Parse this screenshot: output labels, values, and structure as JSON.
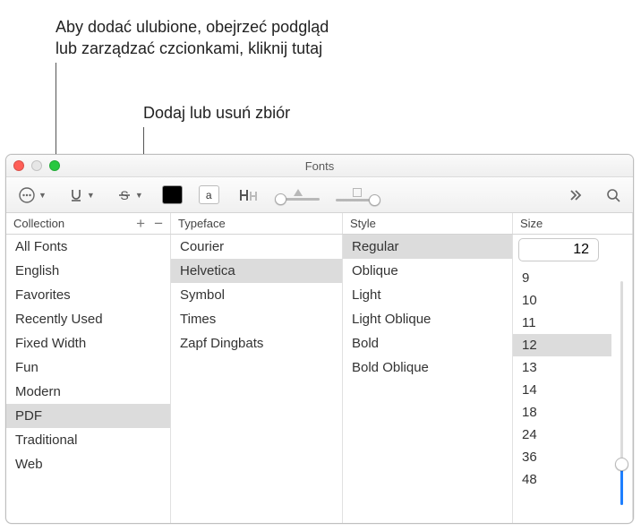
{
  "annotations": {
    "top1_line1": "Aby dodać ulubione, obejrzeć podgląd",
    "top1_line2": "lub zarządzać czcionkami, kliknij tutaj",
    "top2": "Dodaj lub usuń zbiór"
  },
  "window": {
    "title": "Fonts"
  },
  "toolbar": {
    "text_sample": "a"
  },
  "headers": {
    "collection": "Collection",
    "typeface": "Typeface",
    "style": "Style",
    "size": "Size"
  },
  "collections": [
    {
      "label": "All Fonts",
      "selected": false
    },
    {
      "label": "English",
      "selected": false
    },
    {
      "label": "Favorites",
      "selected": false
    },
    {
      "label": "Recently Used",
      "selected": false
    },
    {
      "label": "Fixed Width",
      "selected": false
    },
    {
      "label": "Fun",
      "selected": false
    },
    {
      "label": "Modern",
      "selected": false
    },
    {
      "label": "PDF",
      "selected": true
    },
    {
      "label": "Traditional",
      "selected": false
    },
    {
      "label": "Web",
      "selected": false
    }
  ],
  "typefaces": [
    {
      "label": "Courier",
      "selected": false
    },
    {
      "label": "Helvetica",
      "selected": true
    },
    {
      "label": "Symbol",
      "selected": false
    },
    {
      "label": "Times",
      "selected": false
    },
    {
      "label": "Zapf Dingbats",
      "selected": false
    }
  ],
  "styles": [
    {
      "label": "Regular",
      "selected": true
    },
    {
      "label": "Oblique",
      "selected": false
    },
    {
      "label": "Light",
      "selected": false
    },
    {
      "label": "Light Oblique",
      "selected": false
    },
    {
      "label": "Bold",
      "selected": false
    },
    {
      "label": "Bold Oblique",
      "selected": false
    }
  ],
  "size": {
    "current": "12",
    "options": [
      {
        "label": "9",
        "selected": false
      },
      {
        "label": "10",
        "selected": false
      },
      {
        "label": "11",
        "selected": false
      },
      {
        "label": "12",
        "selected": true
      },
      {
        "label": "13",
        "selected": false
      },
      {
        "label": "14",
        "selected": false
      },
      {
        "label": "18",
        "selected": false
      },
      {
        "label": "24",
        "selected": false
      },
      {
        "label": "36",
        "selected": false
      },
      {
        "label": "48",
        "selected": false
      }
    ]
  }
}
